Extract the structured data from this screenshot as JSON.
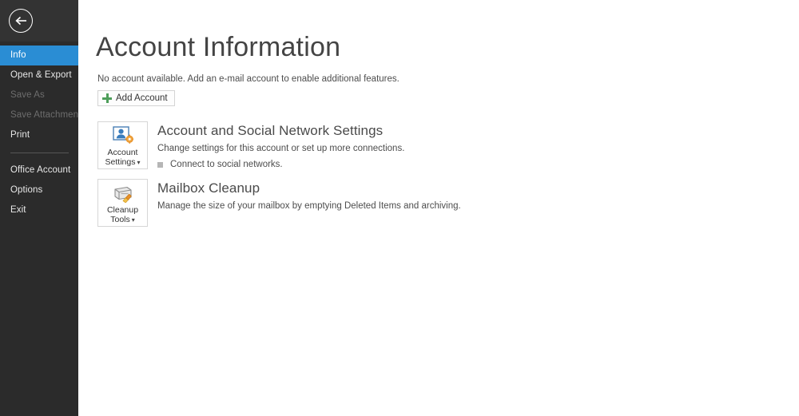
{
  "sidebar": {
    "back_icon": "back-arrow-icon",
    "items": [
      {
        "label": "Info",
        "state": "active"
      },
      {
        "label": "Open & Export",
        "state": "normal"
      },
      {
        "label": "Save As",
        "state": "disabled"
      },
      {
        "label": "Save Attachments",
        "state": "disabled"
      },
      {
        "label": "Print",
        "state": "normal"
      }
    ],
    "items_lower": [
      {
        "label": "Office Account",
        "state": "normal"
      },
      {
        "label": "Options",
        "state": "normal"
      },
      {
        "label": "Exit",
        "state": "normal"
      }
    ],
    "accent_color": "#2a8dd4",
    "background_color": "#2b2b2b"
  },
  "main": {
    "title": "Account Information",
    "subtitle": "No account available. Add an e-mail account to enable additional features.",
    "add_account_label": "Add Account",
    "sections": [
      {
        "button_line1": "Account",
        "button_line2": "Settings",
        "button_caret": "▾",
        "icon": "account-settings-icon",
        "title": "Account and Social Network Settings",
        "description": "Change settings for this account or set up more connections.",
        "bullet": "Connect to social networks."
      },
      {
        "button_line1": "Cleanup",
        "button_line2": "Tools",
        "button_caret": "▾",
        "icon": "mailbox-cleanup-icon",
        "title": "Mailbox Cleanup",
        "description": "Manage the size of your mailbox by emptying Deleted Items and archiving.",
        "bullet": ""
      }
    ]
  }
}
